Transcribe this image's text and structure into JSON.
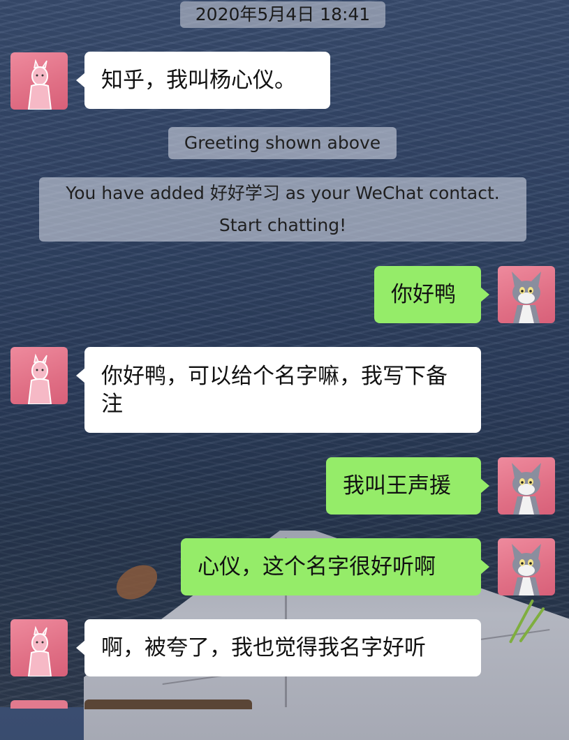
{
  "chat": {
    "timestamp": "2020年5月4日 18:41",
    "system_greeting": "Greeting shown above",
    "system_added_line1": "You have added 好好学习 as your WeChat contact.",
    "system_added_line2": "Start chatting!",
    "messages": [
      {
        "direction": "incoming",
        "text": "知乎，我叫杨心仪。"
      },
      {
        "direction": "outgoing",
        "text": "你好鸭"
      },
      {
        "direction": "incoming",
        "text": "你好鸭，可以给个名字嘛，我写下备注"
      },
      {
        "direction": "outgoing",
        "text": "我叫王声援"
      },
      {
        "direction": "outgoing",
        "text": "心仪，这个名字很好听啊"
      },
      {
        "direction": "incoming",
        "text": "啊，被夸了，我也觉得我名字好听"
      }
    ]
  },
  "avatars": {
    "contact_icon": "pink-panther-avatar-icon",
    "self_icon": "tom-cat-avatar-icon"
  },
  "colors": {
    "outgoing_bubble": "#95ec69",
    "incoming_bubble": "#ffffff",
    "avatar_bg": "#e06f85"
  }
}
